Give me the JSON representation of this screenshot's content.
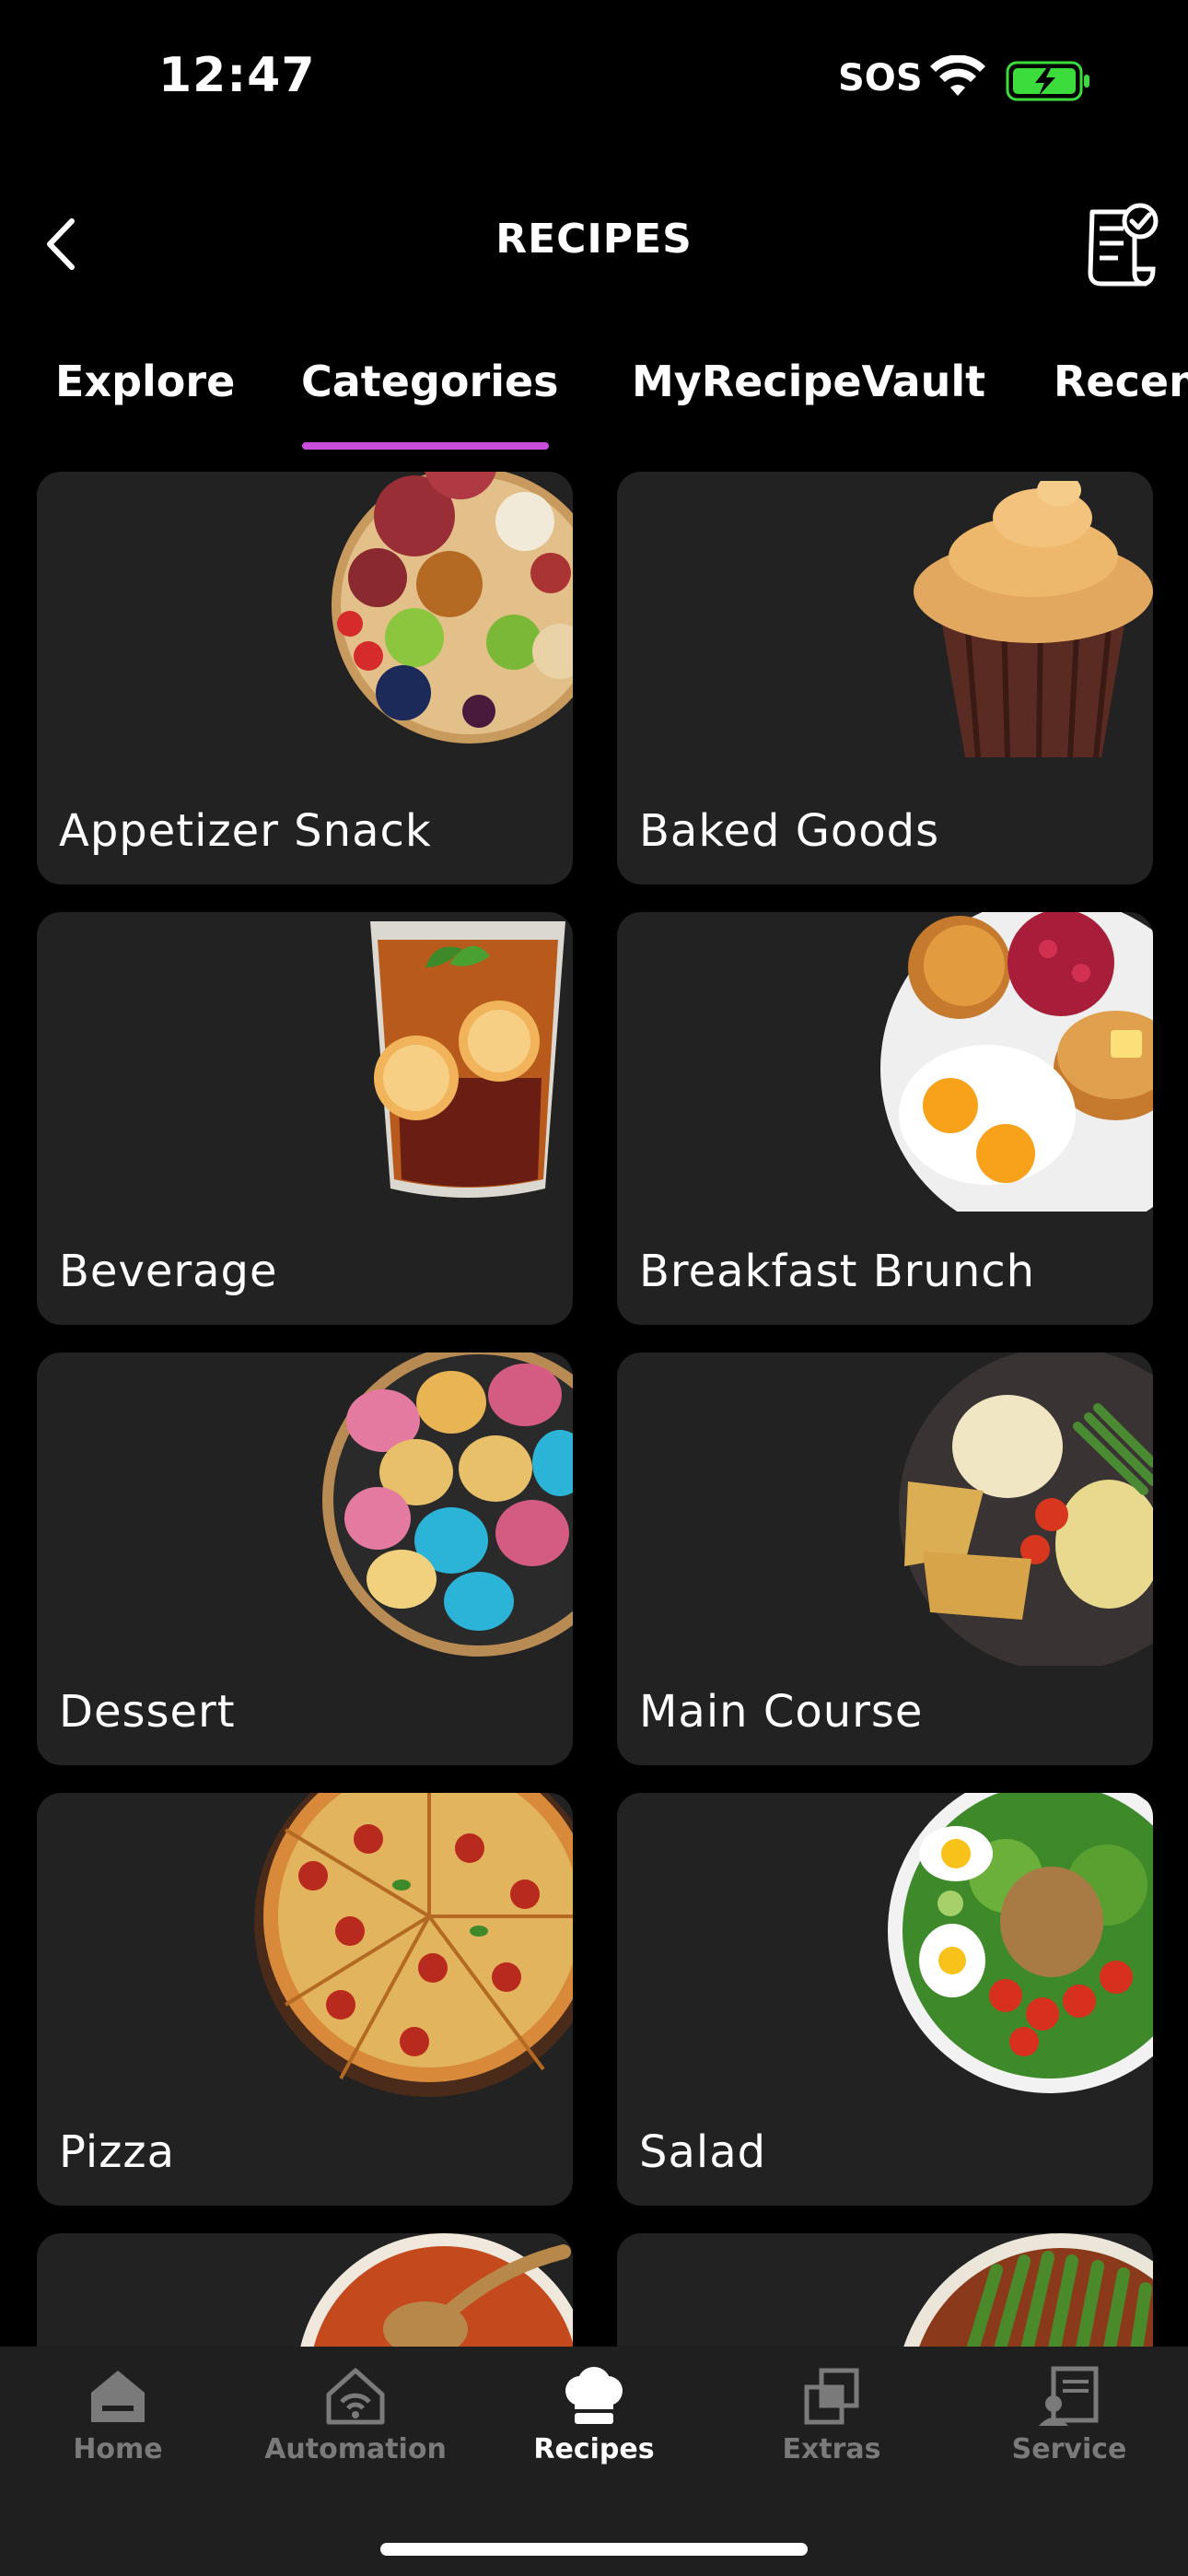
{
  "status": {
    "time": "12:47",
    "carrier": "SOS"
  },
  "header": {
    "title": "RECIPES"
  },
  "tabs": [
    {
      "label": "Explore"
    },
    {
      "label": "Categories"
    },
    {
      "label": "MyRecipeVault"
    },
    {
      "label": "Recent"
    }
  ],
  "categories": [
    {
      "label": "Appetizer Snack"
    },
    {
      "label": "Baked Goods"
    },
    {
      "label": "Beverage"
    },
    {
      "label": "Breakfast Brunch"
    },
    {
      "label": "Dessert"
    },
    {
      "label": "Main Course"
    },
    {
      "label": "Pizza"
    },
    {
      "label": "Salad"
    },
    {
      "label": ""
    },
    {
      "label": ""
    }
  ],
  "bottom_nav": [
    {
      "label": "Home"
    },
    {
      "label": "Automation"
    },
    {
      "label": "Recipes"
    },
    {
      "label": "Extras"
    },
    {
      "label": "Service"
    }
  ],
  "colors": {
    "accent": "#c84ddb",
    "card": "#222222",
    "background": "#000000",
    "battery": "#3ddc3d"
  }
}
